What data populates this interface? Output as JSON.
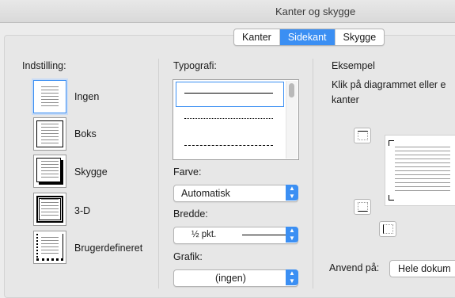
{
  "window": {
    "title": "Kanter og skygge"
  },
  "tabs": [
    {
      "label": "Kanter",
      "active": false
    },
    {
      "label": "Sidekant",
      "active": true
    },
    {
      "label": "Skygge",
      "active": false
    }
  ],
  "setting": {
    "heading": "Indstilling:",
    "options": [
      {
        "label": "Ingen",
        "selected": true,
        "icon": "setting-none-icon"
      },
      {
        "label": "Boks",
        "selected": false,
        "icon": "setting-box-icon"
      },
      {
        "label": "Skygge",
        "selected": false,
        "icon": "setting-shadow-icon"
      },
      {
        "label": "3-D",
        "selected": false,
        "icon": "setting-3d-icon"
      },
      {
        "label": "Brugerdefineret",
        "selected": false,
        "icon": "setting-custom-icon"
      }
    ]
  },
  "style": {
    "heading": "Typografi:",
    "color_label": "Farve:",
    "color_value": "Automatisk",
    "width_label": "Bredde:",
    "width_value": "½ pkt.",
    "art_label": "Grafik:",
    "art_value": "(ingen)"
  },
  "preview": {
    "heading": "Eksempel",
    "hint": "Klik på diagrammet eller e",
    "hint2": "kanter"
  },
  "apply": {
    "label": "Anvend på:",
    "value": "Hele dokum"
  },
  "colors": {
    "accent": "#3b8ff3",
    "panel": "#e7e7e7"
  }
}
